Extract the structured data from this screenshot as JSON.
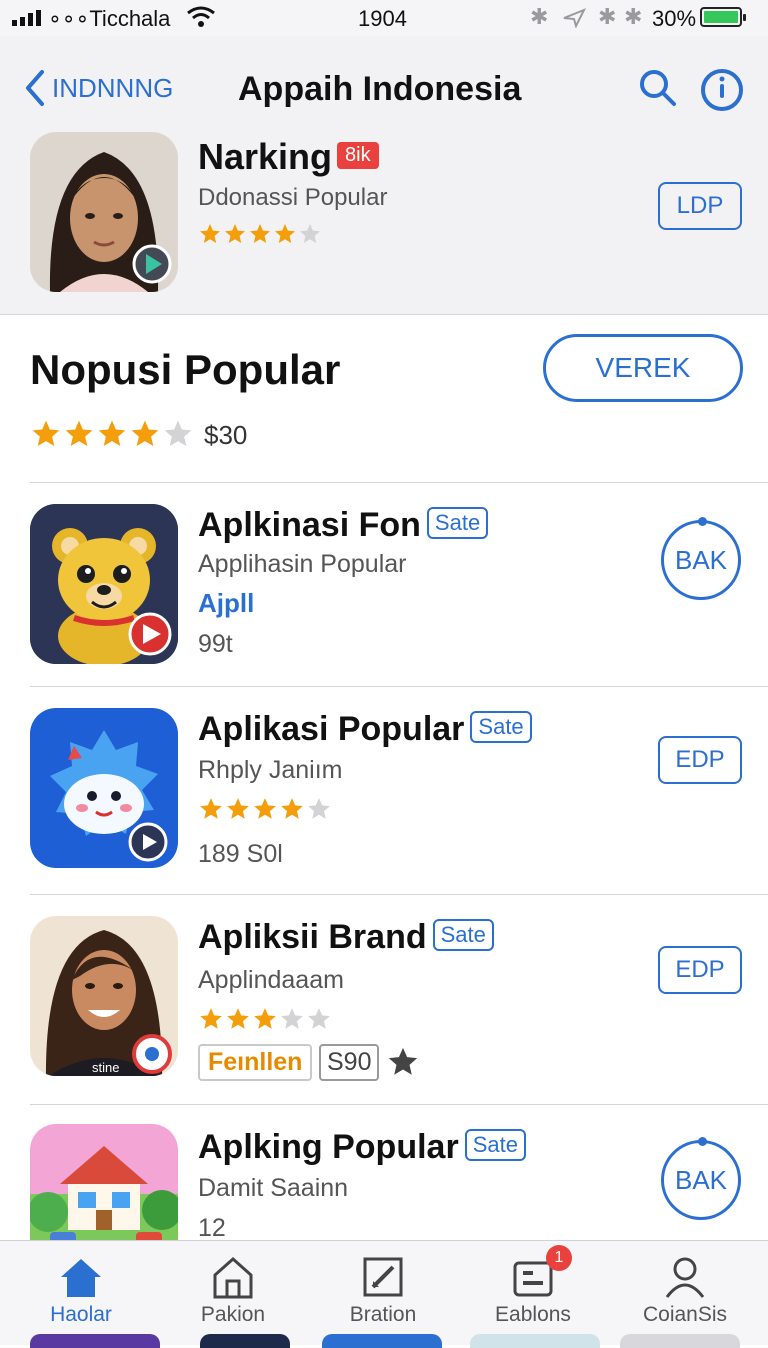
{
  "status": {
    "carrier": "∘∘∘Ticchala",
    "time": "1904",
    "battery": "30%"
  },
  "nav": {
    "back": "INDNNNG",
    "title": "Appaih Indonesia"
  },
  "featured": {
    "title": "Narking",
    "badge": "8ik",
    "subtitle": "Ddonassi Popular",
    "rating": 4,
    "button": "LDP"
  },
  "section": {
    "title": "Nopusi Popular",
    "button": "VEREK",
    "rating": 4,
    "price": "$30"
  },
  "apps": [
    {
      "title": "Aplkinasi Fon",
      "tag": "Sate",
      "subtitle": "Applihasin Popular",
      "link": "Ajpll",
      "meta": "99t",
      "button": "BAK",
      "icon": "bear-app-icon"
    },
    {
      "title": "Aplikasi Popular",
      "tag": "Sate",
      "subtitle": "Rhply Janiım",
      "rating": 4,
      "meta": "189 S0l",
      "button": "EDP",
      "icon": "cloud-mascot-app-icon"
    },
    {
      "title": "Apliksii Brand",
      "tag": "Sate",
      "subtitle": "Applindaaam",
      "rating": 3,
      "chip_orange": "Feınllen",
      "chip_grey": "S90",
      "button": "EDP",
      "icon": "woman-portrait-app-icon"
    },
    {
      "title": "Aplking Popular",
      "tag": "Sate",
      "subtitle": "Damit Saainn",
      "meta": "12",
      "button": "BAK",
      "icon": "house-app-icon"
    }
  ],
  "tabs": [
    {
      "label": "Haolar",
      "icon": "home-icon"
    },
    {
      "label": "Pakion",
      "icon": "building-icon"
    },
    {
      "label": "Bration",
      "icon": "edit-icon"
    },
    {
      "label": "Eablons",
      "icon": "inbox-icon",
      "badge": "1"
    },
    {
      "label": "CoianSis",
      "icon": "profile-icon"
    }
  ],
  "colors": {
    "accent": "#2b6fd1",
    "star": "#f59e0b",
    "badge": "#e9423e"
  }
}
